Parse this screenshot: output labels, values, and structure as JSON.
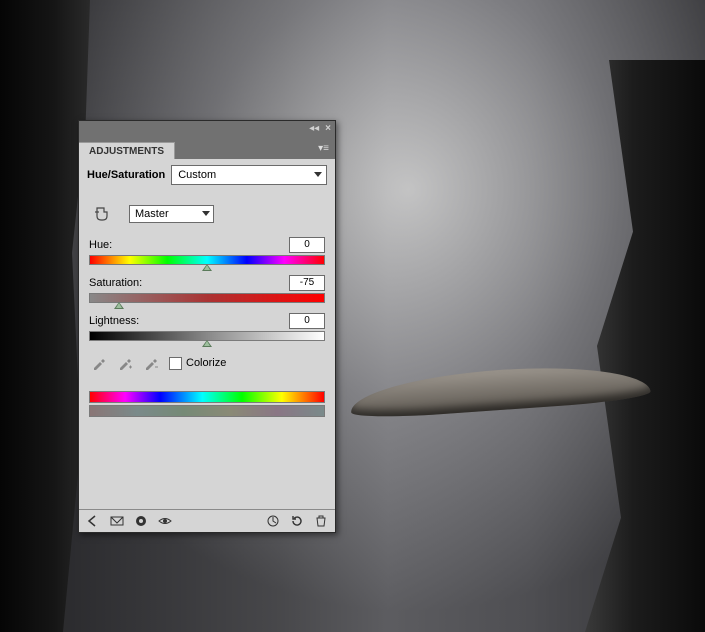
{
  "panel": {
    "title_tab": "ADJUSTMENTS",
    "adjustment_name": "Hue/Saturation",
    "preset_value": "Custom",
    "channel_value": "Master",
    "sliders": {
      "hue": {
        "label": "Hue:",
        "value": "0",
        "pos_pct": 50
      },
      "saturation": {
        "label": "Saturation:",
        "value": "-75",
        "pos_pct": 12.5
      },
      "lightness": {
        "label": "Lightness:",
        "value": "0",
        "pos_pct": 50
      }
    },
    "colorize_label": "Colorize",
    "colorize_checked": false
  }
}
